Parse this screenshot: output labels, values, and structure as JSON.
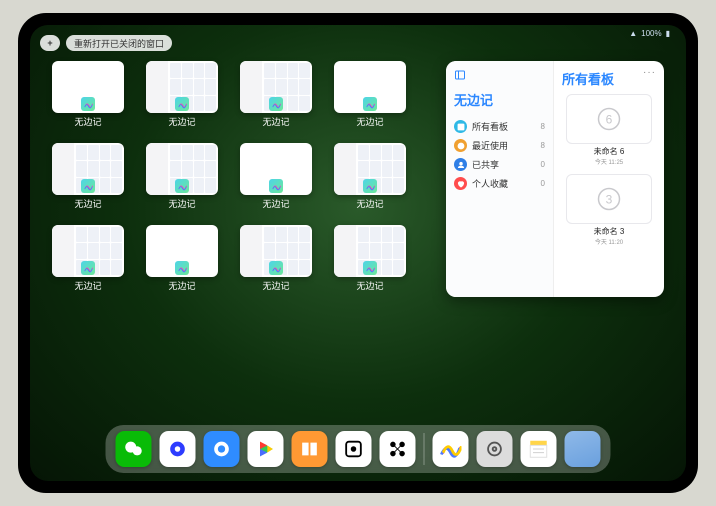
{
  "status": {
    "wifi": "􀙇",
    "battery": "100%"
  },
  "topbar": {
    "plus": "+",
    "reopen_label": "重新打开已关闭的窗口"
  },
  "app_name": "无边记",
  "thumbs": [
    {
      "label": "无边记",
      "variant": "blank"
    },
    {
      "label": "无边记",
      "variant": "content"
    },
    {
      "label": "无边记",
      "variant": "content"
    },
    {
      "label": "无边记",
      "variant": "blank"
    },
    {
      "label": "无边记",
      "variant": "content"
    },
    {
      "label": "无边记",
      "variant": "content"
    },
    {
      "label": "无边记",
      "variant": "blank"
    },
    {
      "label": "无边记",
      "variant": "content"
    },
    {
      "label": "无边记",
      "variant": "content"
    },
    {
      "label": "无边记",
      "variant": "blank"
    },
    {
      "label": "无边记",
      "variant": "content"
    },
    {
      "label": "无边记",
      "variant": "content"
    }
  ],
  "panel": {
    "left_title": "无边记",
    "right_title": "所有看板",
    "more": "···",
    "menu": [
      {
        "icon": "layout",
        "color": "#2fb9e6",
        "label": "所有看板",
        "count": "8"
      },
      {
        "icon": "clock",
        "color": "#f0a030",
        "label": "最近使用",
        "count": "8"
      },
      {
        "icon": "person",
        "color": "#2f7fe6",
        "label": "已共享",
        "count": "0"
      },
      {
        "icon": "heart",
        "color": "#ff4d4d",
        "label": "个人收藏",
        "count": "0"
      }
    ],
    "boards": [
      {
        "name": "未命名 6",
        "sub": "今天 11:25",
        "glyph": "6"
      },
      {
        "name": "未命名 3",
        "sub": "今天 11:20",
        "glyph": "3"
      }
    ]
  },
  "dock": [
    {
      "name": "wechat",
      "bg": "#09bb07"
    },
    {
      "name": "quark",
      "bg": "#ffffff"
    },
    {
      "name": "qqbrowser",
      "bg": "#2f8cff"
    },
    {
      "name": "play",
      "bg": "#ffffff"
    },
    {
      "name": "books",
      "bg": "#ff9933"
    },
    {
      "name": "dice",
      "bg": "#ffffff"
    },
    {
      "name": "hex",
      "bg": "#ffffff"
    },
    {
      "name": "freeform",
      "bg": "#ffffff"
    },
    {
      "name": "settings",
      "bg": "#dcdcdc"
    },
    {
      "name": "notes",
      "bg": "#ffffff"
    },
    {
      "name": "folder",
      "bg": "folder"
    }
  ]
}
